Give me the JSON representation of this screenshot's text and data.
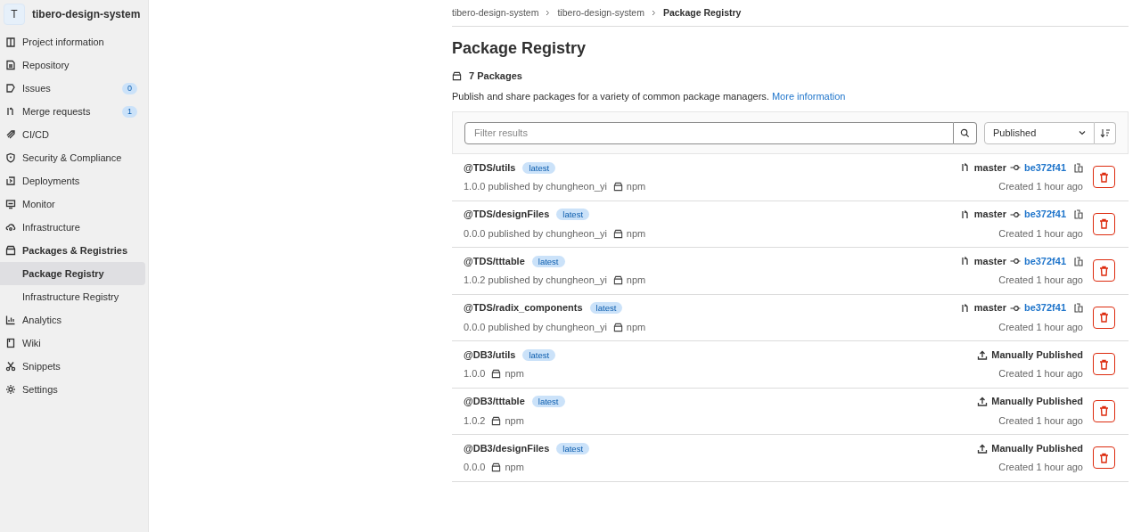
{
  "sidebar": {
    "avatar": "T",
    "project": "tibero-design-system",
    "items": [
      {
        "label": "Project information",
        "kind": "item",
        "selected": false
      },
      {
        "label": "Repository",
        "kind": "item",
        "selected": false
      },
      {
        "label": "Issues",
        "kind": "item",
        "selected": false,
        "count": "0"
      },
      {
        "label": "Merge requests",
        "kind": "item",
        "selected": false,
        "count": "1"
      },
      {
        "label": "CI/CD",
        "kind": "item",
        "selected": false
      },
      {
        "label": "Security & Compliance",
        "kind": "item",
        "selected": false
      },
      {
        "label": "Deployments",
        "kind": "item",
        "selected": false
      },
      {
        "label": "Monitor",
        "kind": "item",
        "selected": false
      },
      {
        "label": "Infrastructure",
        "kind": "item",
        "selected": false
      },
      {
        "label": "Packages & Registries",
        "kind": "section",
        "selected": false
      },
      {
        "label": "Package Registry",
        "kind": "subitem",
        "selected": true
      },
      {
        "label": "Infrastructure Registry",
        "kind": "subitem",
        "selected": false
      },
      {
        "label": "Analytics",
        "kind": "item",
        "selected": false
      },
      {
        "label": "Wiki",
        "kind": "item",
        "selected": false
      },
      {
        "label": "Snippets",
        "kind": "item",
        "selected": false
      },
      {
        "label": "Settings",
        "kind": "item",
        "selected": false
      }
    ]
  },
  "breadcrumbs": [
    "tibero-design-system",
    "tibero-design-system",
    "Package Registry"
  ],
  "title": "Package Registry",
  "count": "7 Packages",
  "description": "Publish and share packages for a variety of common package managers.",
  "link": "More information",
  "filter": {
    "placeholder": "Filter results",
    "sort": "Published"
  },
  "packages": [
    {
      "name": "@TDS/utils",
      "badge": "latest",
      "version": "1.0.0",
      "publisher": "published by chungheon_yi",
      "type": "npm",
      "kind": "pipeline",
      "branch": "master",
      "commit": "be372f41",
      "created": "Created 1 hour ago"
    },
    {
      "name": "@TDS/designFiles",
      "badge": "latest",
      "version": "0.0.0",
      "publisher": "published by chungheon_yi",
      "type": "npm",
      "kind": "pipeline",
      "branch": "master",
      "commit": "be372f41",
      "created": "Created 1 hour ago"
    },
    {
      "name": "@TDS/tttable",
      "badge": "latest",
      "version": "1.0.2",
      "publisher": "published by chungheon_yi",
      "type": "npm",
      "kind": "pipeline",
      "branch": "master",
      "commit": "be372f41",
      "created": "Created 1 hour ago"
    },
    {
      "name": "@TDS/radix_components",
      "badge": "latest",
      "version": "0.0.0",
      "publisher": "published by chungheon_yi",
      "type": "npm",
      "kind": "pipeline",
      "branch": "master",
      "commit": "be372f41",
      "created": "Created 1 hour ago"
    },
    {
      "name": "@DB3/utils",
      "badge": "latest",
      "version": "1.0.0",
      "type": "npm",
      "kind": "manual",
      "source": "Manually Published",
      "created": "Created 1 hour ago"
    },
    {
      "name": "@DB3/tttable",
      "badge": "latest",
      "version": "1.0.2",
      "type": "npm",
      "kind": "manual",
      "source": "Manually Published",
      "created": "Created 1 hour ago"
    },
    {
      "name": "@DB3/designFiles",
      "badge": "latest",
      "version": "0.0.0",
      "type": "npm",
      "kind": "manual",
      "source": "Manually Published",
      "created": "Created 1 hour ago"
    }
  ]
}
